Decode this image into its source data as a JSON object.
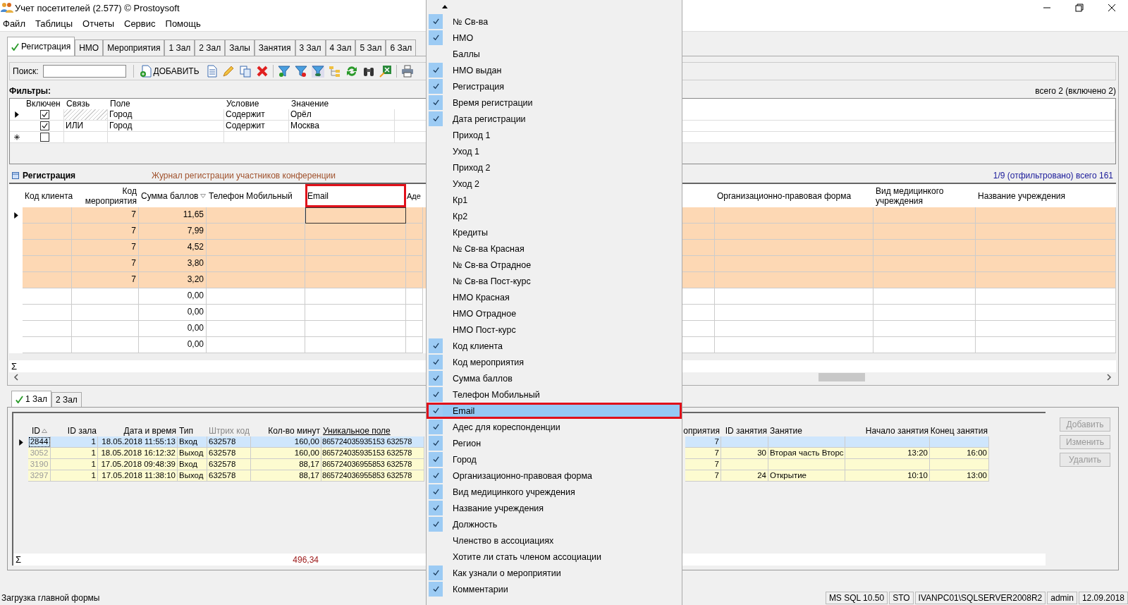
{
  "window": {
    "title": "Учет посетителей (2.577) © Prostoysoft"
  },
  "menu_bar": [
    "Файл",
    "Таблицы",
    "Отчеты",
    "Сервис",
    "Помощь"
  ],
  "tabs": [
    {
      "label": "Регистрация",
      "selected": true
    },
    {
      "label": "НМО",
      "selected": false
    },
    {
      "label": "Мероприятия",
      "selected": false
    },
    {
      "label": "1 Зал",
      "selected": false
    },
    {
      "label": "2 Зал",
      "selected": false
    },
    {
      "label": "Залы",
      "selected": false
    },
    {
      "label": "Занятия",
      "selected": false
    },
    {
      "label": "3 Зал",
      "selected": false
    },
    {
      "label": "4 Зал",
      "selected": false
    },
    {
      "label": "5 Зал",
      "selected": false
    },
    {
      "label": "6 Зал",
      "selected": false
    }
  ],
  "toolbar": {
    "search_label": "Поиск:",
    "add_button": "ДОБАВИТЬ"
  },
  "filters": {
    "title": "Фильтры:",
    "summary": "всего 2 (включено 2)",
    "columns": [
      "Включен",
      "Связь",
      "Поле",
      "Условие",
      "Значение"
    ],
    "rows": [
      {
        "current": true,
        "enabled": true,
        "field": "Город",
        "condition": "Содержит",
        "value": "Орёл"
      },
      {
        "current": false,
        "enabled": true,
        "link": "ИЛИ",
        "field": "Город",
        "condition": "Содержит",
        "value": "Москва"
      }
    ],
    "new_row": {
      "enabled": false
    }
  },
  "registration": {
    "title": "Регистрация",
    "subtitle": "Журнал регистрации участников конференции",
    "summary": "1/9 (отфильтровано) всего 161",
    "sum_symbol": "Σ",
    "columns_left": [
      {
        "label": "Код клиента",
        "annotated": false
      },
      {
        "label": "Код мероприятия",
        "annotated": false
      },
      {
        "label": "Сумма баллов",
        "annotated": false
      },
      {
        "label": "Телефон Мобильный",
        "annotated": false
      },
      {
        "label": "Email",
        "annotated": true
      },
      {
        "label": "Аде",
        "annotated": false
      }
    ],
    "columns_right": [
      "Организационно-правовая форма",
      "Вид медицинкого учреждения",
      "Название учреждения"
    ],
    "rows": [
      {
        "current": true,
        "highlighted": true,
        "event": "7",
        "score": "11,65"
      },
      {
        "current": false,
        "highlighted": true,
        "event": "7",
        "score": "7,99"
      },
      {
        "current": false,
        "highlighted": true,
        "event": "7",
        "score": "4,52"
      },
      {
        "current": false,
        "highlighted": true,
        "event": "7",
        "score": "3,80"
      },
      {
        "current": false,
        "highlighted": true,
        "event": "7",
        "score": "3,20"
      },
      {
        "current": false,
        "highlighted": false,
        "score": "0,00"
      },
      {
        "current": false,
        "highlighted": false,
        "score": "0,00"
      },
      {
        "current": false,
        "highlighted": false,
        "score": "0,00"
      },
      {
        "current": false,
        "highlighted": false,
        "score": "0,00"
      }
    ]
  },
  "sessions": {
    "tabs": [
      {
        "label": "1 Зал",
        "selected": true
      },
      {
        "label": "2 Зал",
        "selected": false
      }
    ],
    "sum_symbol": "Σ",
    "total": "496,34",
    "columns_left": [
      "ID",
      "ID зала",
      "Дата и время",
      "Тип",
      "Штрих код",
      "Кол-во минут",
      "Уникальное поле"
    ],
    "columns_right": [
      "оприятия",
      "ID занятия",
      "Занятие",
      "Начало занятия",
      "Конец занятия"
    ],
    "rows": [
      {
        "selected": true,
        "id": "2844",
        "hall": "1",
        "datetime": "18.05.2018 11:55:13",
        "type": "Вход",
        "barcode": "632578",
        "minutes": "160,00",
        "unique": "865724035935153 632578",
        "event": "7"
      },
      {
        "selected": false,
        "id": "3052",
        "hall": "1",
        "datetime": "18.05.2018 16:12:32",
        "type": "Выход",
        "barcode": "632578",
        "minutes": "160,00",
        "unique": "865724035935153 632578",
        "event": "7",
        "session_id": "30",
        "session": "Вторая часть Вторс",
        "start": "13:20",
        "end": "16:00"
      },
      {
        "selected": false,
        "id": "3190",
        "hall": "1",
        "datetime": "17.05.2018 09:48:39",
        "type": "Вход",
        "barcode": "632578",
        "minutes": "88,17",
        "unique": "865724036955853 632578",
        "event": "7"
      },
      {
        "selected": false,
        "id": "3297",
        "hall": "1",
        "datetime": "17.05.2018 11:38:10",
        "type": "Выход",
        "barcode": "632578",
        "minutes": "88,17",
        "unique": "865724036955853 632578",
        "event": "7",
        "session_id": "24",
        "session": "Открытие",
        "start": "10:10",
        "end": "13:00"
      }
    ],
    "buttons": [
      {
        "label": "Добавить",
        "disabled": true
      },
      {
        "label": "Изменить",
        "disabled": true
      },
      {
        "label": "Удалить",
        "disabled": true
      }
    ]
  },
  "status_bar": {
    "message": "Загрузка главной формы",
    "panels": [
      "MS SQL 10.50",
      "STO",
      "IVANPC01\\SQLSERVER2008R2",
      "admin",
      "12.09.2018"
    ]
  },
  "column_menu": {
    "items": [
      {
        "label": "№ Св-ва",
        "checked": true,
        "selected": false
      },
      {
        "label": "НМО",
        "checked": true,
        "selected": false
      },
      {
        "label": "Баллы",
        "checked": false,
        "selected": false
      },
      {
        "label": "НМО выдан",
        "checked": true,
        "selected": false
      },
      {
        "label": "Регистрация",
        "checked": true,
        "selected": false
      },
      {
        "label": "Время регистрации",
        "checked": true,
        "selected": false
      },
      {
        "label": "Дата регистрации",
        "checked": true,
        "selected": false
      },
      {
        "label": "Приход 1",
        "checked": false,
        "selected": false
      },
      {
        "label": "Уход 1",
        "checked": false,
        "selected": false
      },
      {
        "label": "Приход 2",
        "checked": false,
        "selected": false
      },
      {
        "label": "Уход 2",
        "checked": false,
        "selected": false
      },
      {
        "label": "Кр1",
        "checked": false,
        "selected": false
      },
      {
        "label": "Кр2",
        "checked": false,
        "selected": false
      },
      {
        "label": "Кредиты",
        "checked": false,
        "selected": false
      },
      {
        "label": "№ Св-ва Красная",
        "checked": false,
        "selected": false
      },
      {
        "label": "№ Св-ва Отрадное",
        "checked": false,
        "selected": false
      },
      {
        "label": "№ Св-ва Пост-курс",
        "checked": false,
        "selected": false
      },
      {
        "label": "НМО Красная",
        "checked": false,
        "selected": false
      },
      {
        "label": "НМО Отрадное",
        "checked": false,
        "selected": false
      },
      {
        "label": "НМО Пост-курс",
        "checked": false,
        "selected": false
      },
      {
        "label": "Код клиента",
        "checked": true,
        "selected": false
      },
      {
        "label": "Код мероприятия",
        "checked": true,
        "selected": false
      },
      {
        "label": "Сумма баллов",
        "checked": true,
        "selected": false
      },
      {
        "label": "Телефон Мобильный",
        "checked": true,
        "selected": false
      },
      {
        "label": "Email",
        "checked": true,
        "selected": true,
        "annotated": true
      },
      {
        "label": "Адес для кореспонденции",
        "checked": true,
        "selected": false
      },
      {
        "label": "Регион",
        "checked": true,
        "selected": false
      },
      {
        "label": "Город",
        "checked": true,
        "selected": false
      },
      {
        "label": "Организационно-правовая форма",
        "checked": true,
        "selected": false
      },
      {
        "label": "Вид медицинкого учреждения",
        "checked": true,
        "selected": false
      },
      {
        "label": "Название учреждения",
        "checked": true,
        "selected": false
      },
      {
        "label": "Должность",
        "checked": true,
        "selected": false
      },
      {
        "label": "Членство в ассоциациях",
        "checked": false,
        "selected": false
      },
      {
        "label": "Хотите ли стать членом ассоциации",
        "checked": false,
        "selected": false
      },
      {
        "label": "Как узнали о мероприятии",
        "checked": true,
        "selected": false
      },
      {
        "label": "Комментарии",
        "checked": true,
        "selected": false
      }
    ]
  }
}
